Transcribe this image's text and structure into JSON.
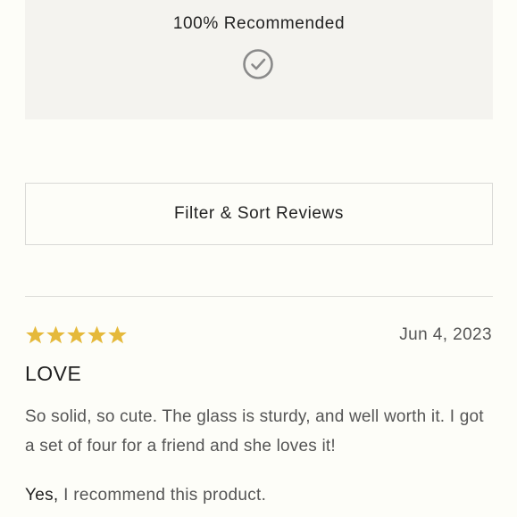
{
  "summary": {
    "recommended_text": "100% Recommended",
    "icon": "check-circle-icon"
  },
  "filter": {
    "button_label": "Filter & Sort Reviews"
  },
  "review": {
    "rating": 5,
    "max_rating": 5,
    "star_color": "#e5b93b",
    "date": "Jun 4, 2023",
    "title": "LOVE",
    "body": "So solid, so cute. The glass is sturdy, and well worth it. I got a set of four for a friend and she loves it!",
    "recommend_yes": "Yes,",
    "recommend_text": " I recommend this product."
  }
}
